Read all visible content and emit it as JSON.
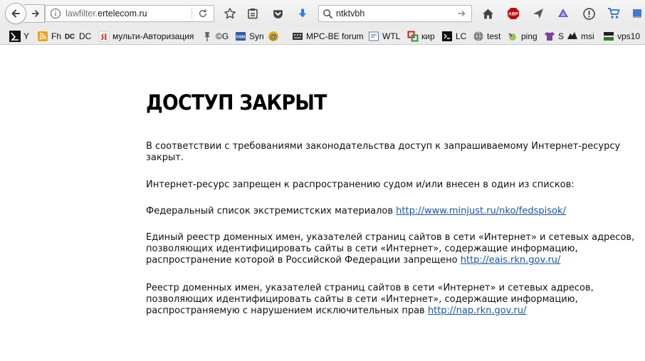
{
  "browser": {
    "url_host": "lawfilter.",
    "url_domain": "ertelecom.ru",
    "search_query": "ntktvbh"
  },
  "bookmarks": [
    {
      "label": "Y",
      "icon": "y-bookmark-icon"
    },
    {
      "label": "Fh",
      "icon": "rss-feed-icon"
    },
    {
      "label": "DC",
      "icon": "dc-icon"
    },
    {
      "label": "мульти-Авторизация",
      "icon": "yandex-icon"
    },
    {
      "label": "©G",
      "icon": "pin-icon"
    },
    {
      "label": "Syn",
      "icon": "dsm-icon"
    },
    {
      "label": "",
      "icon": "at-sign-icon"
    },
    {
      "label": "MPC-BE forum",
      "icon": "film-icon"
    },
    {
      "label": "WTL",
      "icon": "app-window-icon"
    },
    {
      "label": "кир",
      "icon": "squares-icon"
    },
    {
      "label": "LC",
      "icon": "terminal-icon"
    },
    {
      "label": "test",
      "icon": "globe-icon"
    },
    {
      "label": "ping",
      "icon": "ping-icon"
    },
    {
      "label": "S",
      "icon": "tshirt-icon"
    },
    {
      "label": "msi",
      "icon": "dragon-icon"
    },
    {
      "label": "vps10",
      "icon": "server-icon"
    }
  ],
  "page": {
    "title": "ДОСТУП ЗАКРЫТ",
    "intro": "В соответствии с требованиями законодательства доступ к запрашиваемому Интернет-ресурсу закрыт.",
    "reason": "Интернет-ресурс запрещен к распространению судом и/или внесен в один из списков:",
    "list1_text": "Федеральный список экстремистских материалов ",
    "list1_link": "http://www.minjust.ru/nko/fedspisok/",
    "list2_text": "Единый реестр доменных имен, указателей страниц сайтов в сети «Интернет» и сетевых адресов, позволяющих идентифицировать сайты в сети «Интернет», содержащие информацию, распространение которой в Российской Федерации запрещено ",
    "list2_link": "http://eais.rkn.gov.ru/",
    "list3_text": "Реестр доменных имен, указателей страниц сайтов в сети «Интернет» и сетевых адресов, позволяющих идентифицировать сайты в сети «Интернет», содержащие информацию, распространяемую с нарушением исключительных прав ",
    "list3_link": "http://nap.rkn.gov.ru/"
  },
  "colors": {
    "link": "#1a55a6",
    "toolbar_bg": "#ececec",
    "download_arrow": "#2b7de0",
    "abp_red": "#c00a0a"
  }
}
